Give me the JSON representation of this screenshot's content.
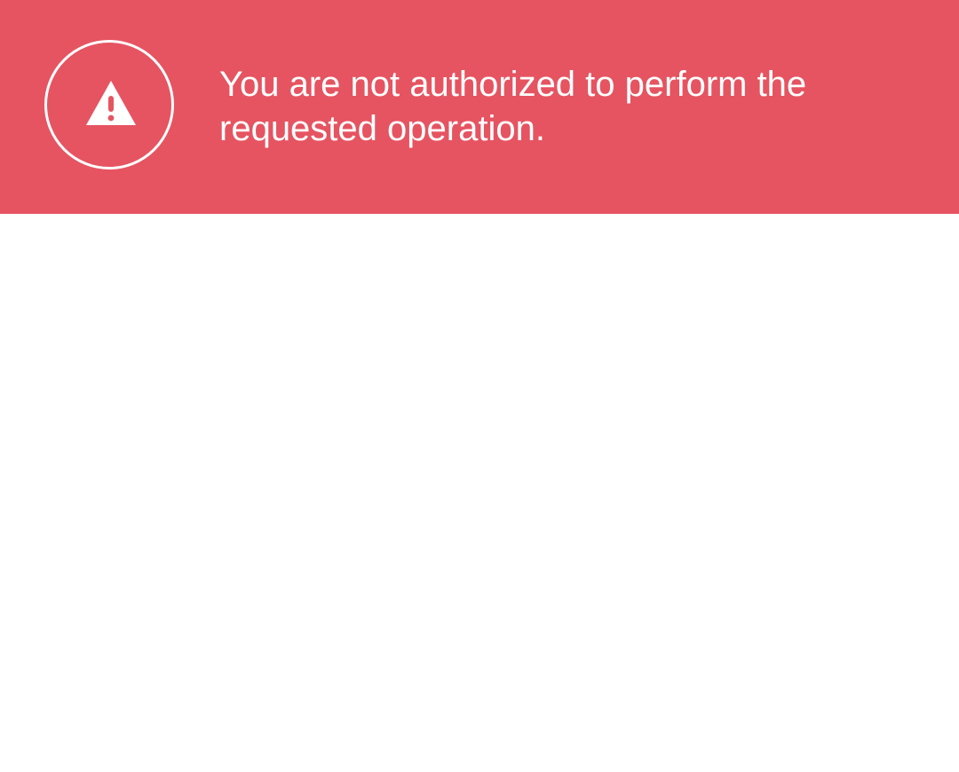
{
  "alert": {
    "message": "You are not authorized to perform the requested operation.",
    "icon": "warning-triangle-icon",
    "colors": {
      "banner_background": "#e65461",
      "foreground": "#ffffff",
      "page_background": "#ffffff"
    }
  }
}
